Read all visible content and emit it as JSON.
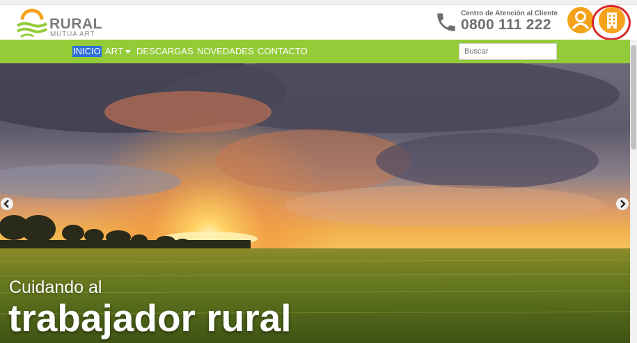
{
  "header": {
    "logo": {
      "name": "RURAL",
      "subtitle": "MUTUA ART"
    },
    "contact": {
      "label": "Centro de Atención al Cliente",
      "phone": "0800 111 222"
    },
    "icons": {
      "user": "user-icon",
      "building": "building-icon",
      "phone": "phone-icon"
    },
    "colors": {
      "accent": "#f4a21c",
      "highlight": "#d9262a"
    }
  },
  "nav": {
    "items": [
      {
        "label": "INICIO",
        "active": true
      },
      {
        "label": "ART",
        "dropdown": true
      },
      {
        "label": "DESCARGAS"
      },
      {
        "label": "NOVEDADES"
      },
      {
        "label": "CONTACTO"
      }
    ],
    "search_placeholder": "Buscar",
    "color": "#94cb38"
  },
  "hero": {
    "subtitle": "Cuidando al",
    "title": "trabajador rural",
    "prev_icon": "chevron-left-icon",
    "next_icon": "chevron-right-icon"
  }
}
